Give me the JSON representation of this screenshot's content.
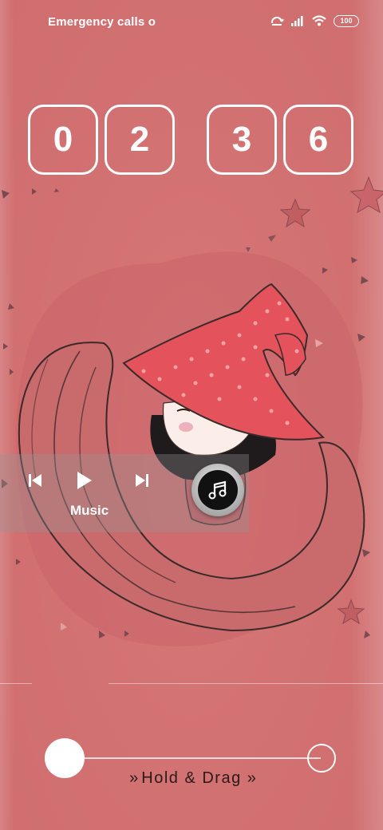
{
  "status_bar": {
    "carrier_text": "Emergency calls o",
    "battery_level": "100",
    "icons": [
      "data-sync-icon",
      "signal-icon",
      "wifi-icon",
      "battery-icon"
    ]
  },
  "clock": {
    "hour_tens": "0",
    "hour_ones": "2",
    "minute_tens": "3",
    "minute_ones": "6"
  },
  "wallpaper": {
    "description_icon": "witch-girl-moon-illustration",
    "colors": {
      "background": "#d37272",
      "hat": "#e8555f",
      "moon": "#cf6868"
    }
  },
  "music_widget": {
    "label": "Music",
    "icons": [
      "previous-icon",
      "play-icon",
      "next-icon",
      "music-note-icon"
    ]
  },
  "unlock_slider": {
    "hint_prefix": "»",
    "hint_text": "Hold & Drag",
    "hint_suffix": "»",
    "progress": 0
  }
}
